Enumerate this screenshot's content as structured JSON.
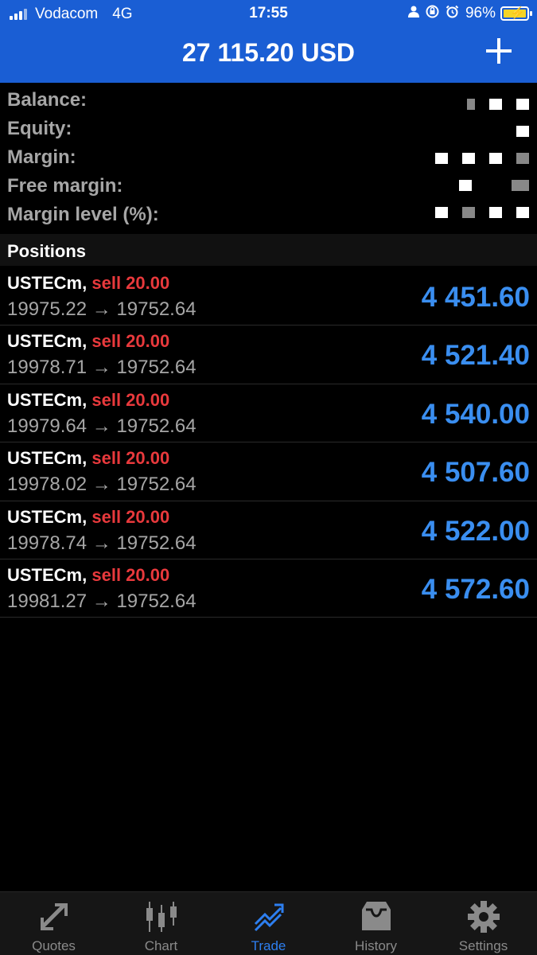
{
  "status_bar": {
    "carrier": "Vodacom",
    "network": "4G",
    "time": "17:55",
    "battery": "96%",
    "icons": [
      "signal-icon",
      "person-icon",
      "rotation-lock-icon",
      "alarm-icon",
      "battery-charging-icon"
    ]
  },
  "header": {
    "title": "27 115.20 USD",
    "add_icon": "plus-icon"
  },
  "account": {
    "rows": [
      {
        "label": "Balance:"
      },
      {
        "label": "Equity:"
      },
      {
        "label": "Margin:"
      },
      {
        "label": "Free margin:"
      },
      {
        "label": "Margin level (%):"
      }
    ]
  },
  "positions": {
    "title": "Positions",
    "items": [
      {
        "symbol": "USTECm,",
        "side": "sell 20.00",
        "prices": "19975.22 → 19752.64",
        "profit": "4 451.60"
      },
      {
        "symbol": "USTECm,",
        "side": "sell 20.00",
        "prices": "19978.71 → 19752.64",
        "profit": "4 521.40"
      },
      {
        "symbol": "USTECm,",
        "side": "sell 20.00",
        "prices": "19979.64 → 19752.64",
        "profit": "4 540.00"
      },
      {
        "symbol": "USTECm,",
        "side": "sell 20.00",
        "prices": "19978.02 → 19752.64",
        "profit": "4 507.60"
      },
      {
        "symbol": "USTECm,",
        "side": "sell 20.00",
        "prices": "19978.74 → 19752.64",
        "profit": "4 522.00"
      },
      {
        "symbol": "USTECm,",
        "side": "sell 20.00",
        "prices": "19981.27 → 19752.64",
        "profit": "4 572.60"
      }
    ]
  },
  "tabs": [
    {
      "label": "Quotes",
      "icon": "quotes-icon",
      "active": false
    },
    {
      "label": "Chart",
      "icon": "candlestick-chart-icon",
      "active": false
    },
    {
      "label": "Trade",
      "icon": "trade-icon",
      "active": true
    },
    {
      "label": "History",
      "icon": "history-inbox-icon",
      "active": false
    },
    {
      "label": "Settings",
      "icon": "gear-icon",
      "active": false
    }
  ],
  "colors": {
    "header_blue": "#1a5ed4",
    "sell_red": "#e8393c",
    "profit_blue": "#3a8ef0",
    "active_tab": "#2d7ff0",
    "inactive_tab": "#8a8a8a"
  }
}
